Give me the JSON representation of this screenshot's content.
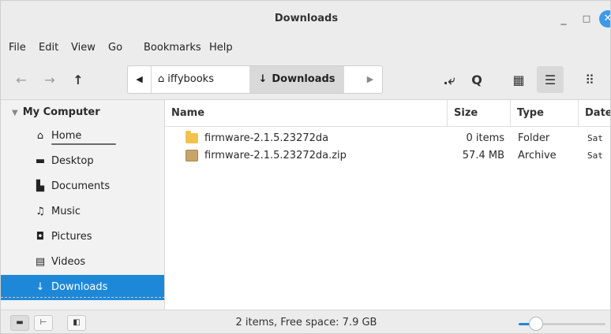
{
  "window": {
    "title": "Downloads",
    "accent": "#1e88d8"
  },
  "menu": [
    "File",
    "Edit",
    "View",
    "Go",
    "Bookmarks",
    "Help"
  ],
  "toolbar": {
    "back_icon": "←",
    "forward_icon": "→",
    "up_icon": "↑",
    "crumb_left": "◀",
    "crumb_home_label": "iffybooks",
    "crumb_current_label": "Downloads",
    "crumb_right": "▶",
    "toggle_location_icon": ".⤶",
    "search_icon": "Q",
    "icon_view": "▦",
    "list_view": "☰",
    "compact_view": "⠿"
  },
  "sidebar": {
    "header": "My Computer",
    "items": [
      {
        "label": "Home",
        "icon": "⌂"
      },
      {
        "label": "Desktop",
        "icon": "▬"
      },
      {
        "label": "Documents",
        "icon": "▙"
      },
      {
        "label": "Music",
        "icon": "♫"
      },
      {
        "label": "Pictures",
        "icon": "◘"
      },
      {
        "label": "Videos",
        "icon": "▤"
      },
      {
        "label": "Downloads",
        "icon": "↓"
      }
    ]
  },
  "columns": {
    "name": "Name",
    "size": "Size",
    "type": "Type",
    "date": "Date"
  },
  "files": [
    {
      "name": "firmware-2.1.5.23272da",
      "size": "0 items",
      "type": "Folder",
      "date": "Sat"
    },
    {
      "name": "firmware-2.1.5.23272da.zip",
      "size": "57.4 MB",
      "type": "Archive",
      "date": "Sat"
    }
  ],
  "status": {
    "text": "2 items, Free space: 7.9 GB",
    "zoom_level": 0.2
  }
}
